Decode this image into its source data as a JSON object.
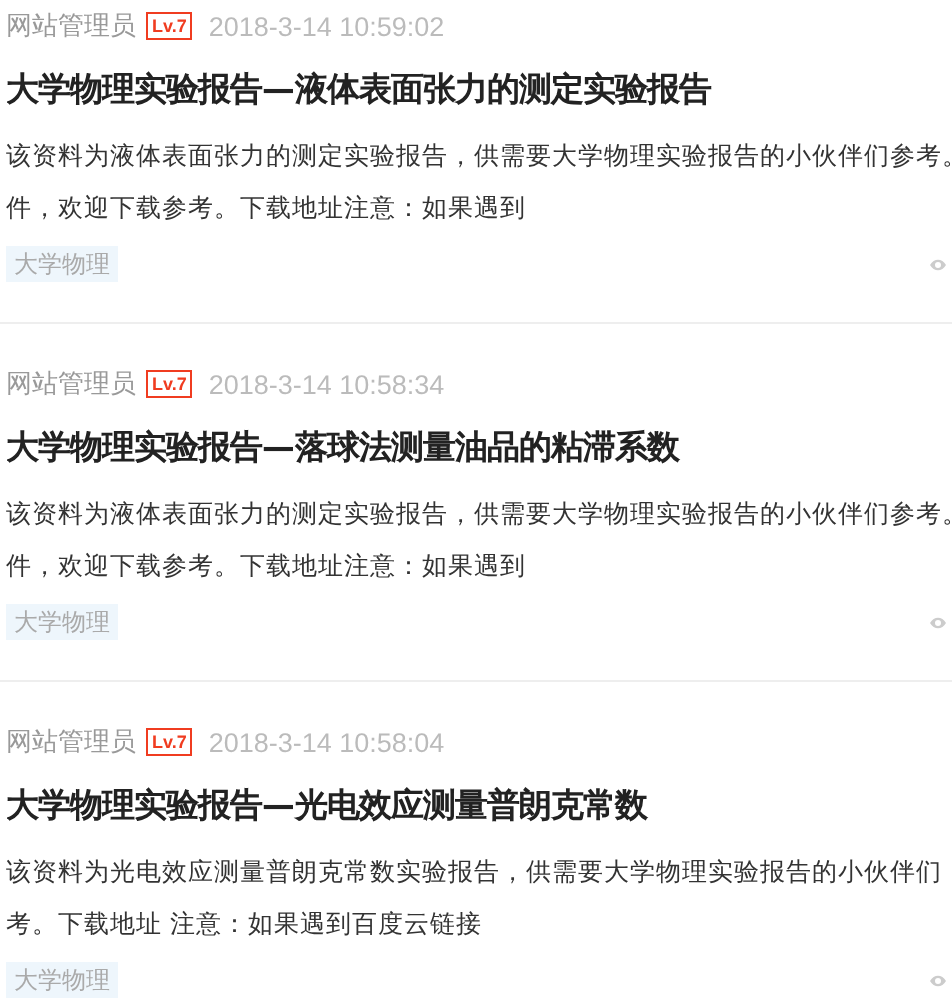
{
  "articles": [
    {
      "author": "网站管理员",
      "level": "Lv.7",
      "time": "2018-3-14 10:59:02",
      "title": "大学物理实验报告—液体表面张力的测定实验报告",
      "description_lines": [
        "该资料为液体表面张力的测定实验报告，供需要大学物理实验报告的小伙伴们参考。",
        "件，欢迎下载参考。下载地址注意：如果遇到"
      ],
      "tags": [
        "大学物理"
      ]
    },
    {
      "author": "网站管理员",
      "level": "Lv.7",
      "time": "2018-3-14 10:58:34",
      "title": "大学物理实验报告—落球法测量油品的粘滞系数",
      "description_lines": [
        "该资料为液体表面张力的测定实验报告，供需要大学物理实验报告的小伙伴们参考。",
        "件，欢迎下载参考。下载地址注意：如果遇到"
      ],
      "tags": [
        "大学物理"
      ]
    },
    {
      "author": "网站管理员",
      "level": "Lv.7",
      "time": "2018-3-14 10:58:04",
      "title": "大学物理实验报告—光电效应测量普朗克常数",
      "description_lines": [
        "该资料为光电效应测量普朗克常数实验报告，供需要大学物理实验报告的小伙伴们",
        "考。下载地址 注意：如果遇到百度云链接"
      ],
      "tags": [
        "大学物理"
      ]
    }
  ]
}
